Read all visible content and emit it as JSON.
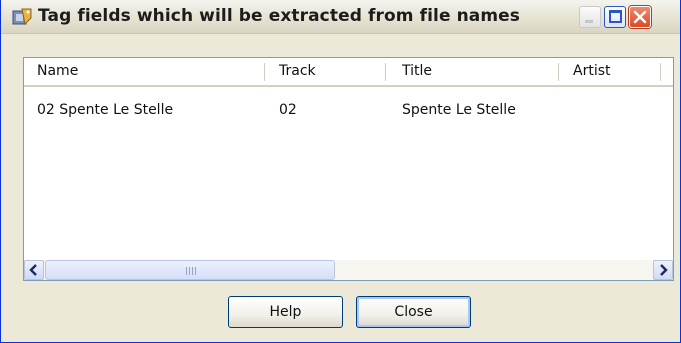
{
  "window": {
    "title": "Tag fields which will be extracted from file names",
    "icon": "tag-fields-app-icon"
  },
  "titlebar_buttons": {
    "minimize_icon": "minimize-icon",
    "maximize_icon": "maximize-icon",
    "close_icon": "close-icon"
  },
  "list": {
    "columns": [
      {
        "label": "Name"
      },
      {
        "label": "Track"
      },
      {
        "label": "Title"
      },
      {
        "label": "Artist"
      }
    ],
    "rows": [
      {
        "name": "02 Spente Le Stelle",
        "track": "02",
        "title": "Spente Le Stelle",
        "artist": ""
      }
    ]
  },
  "scrollbar": {
    "left_arrow": "arrow-left-icon",
    "right_arrow": "arrow-right-icon"
  },
  "buttons": {
    "help_label": "Help",
    "close_label": "Close"
  },
  "colors": {
    "border_blue": "#0831d9",
    "dialog_bg": "#ece9d8",
    "close_red": "#d94a26"
  }
}
